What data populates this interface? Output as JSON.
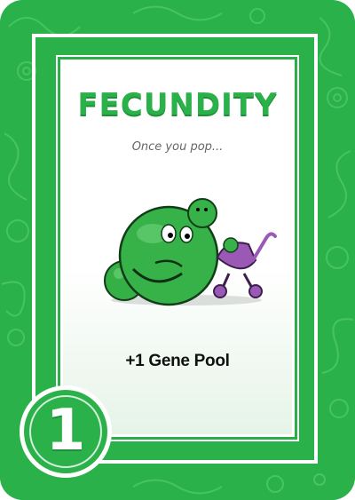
{
  "card": {
    "title": "FECUNDITY",
    "flavor_text": "Once you pop...",
    "effect": "+1 Gene Pool",
    "cost": "1"
  },
  "colors": {
    "brand_green": "#2bb14a",
    "dark_green": "#1f8f3a",
    "stroller_purple": "#9b59b6"
  }
}
